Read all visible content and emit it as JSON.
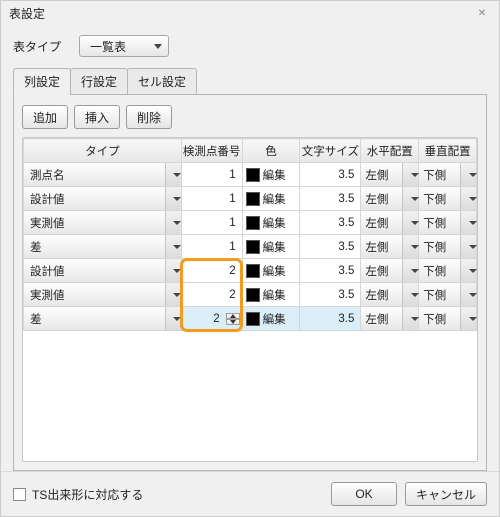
{
  "title": "表設定",
  "tableTypeLabel": "表タイプ",
  "tableTypeValue": "一覧表",
  "tabs": {
    "t0": "列設定",
    "t1": "行設定",
    "t2": "セル設定"
  },
  "toolbar": {
    "add": "追加",
    "insert": "挿入",
    "delete": "削除"
  },
  "headers": {
    "type": "タイプ",
    "no": "検測点番号",
    "color": "色",
    "fs": "文字サイズ",
    "ha": "水平配置",
    "va": "垂直配置"
  },
  "colorEdit": "編集",
  "rows": [
    {
      "type": "測点名",
      "no": "1",
      "fs": "3.5",
      "ha": "左側",
      "va": "下側"
    },
    {
      "type": "設計値",
      "no": "1",
      "fs": "3.5",
      "ha": "左側",
      "va": "下側"
    },
    {
      "type": "実測値",
      "no": "1",
      "fs": "3.5",
      "ha": "左側",
      "va": "下側"
    },
    {
      "type": "差",
      "no": "1",
      "fs": "3.5",
      "ha": "左側",
      "va": "下側"
    },
    {
      "type": "設計値",
      "no": "2",
      "fs": "3.5",
      "ha": "左側",
      "va": "下側"
    },
    {
      "type": "実測値",
      "no": "2",
      "fs": "3.5",
      "ha": "左側",
      "va": "下側"
    },
    {
      "type": "差",
      "no": "2",
      "fs": "3.5",
      "ha": "左側",
      "va": "下側"
    }
  ],
  "selectedRow": 6,
  "footer": {
    "checkboxLabel": "TS出来形に対応する",
    "ok": "OK",
    "cancel": "キャンセル"
  }
}
